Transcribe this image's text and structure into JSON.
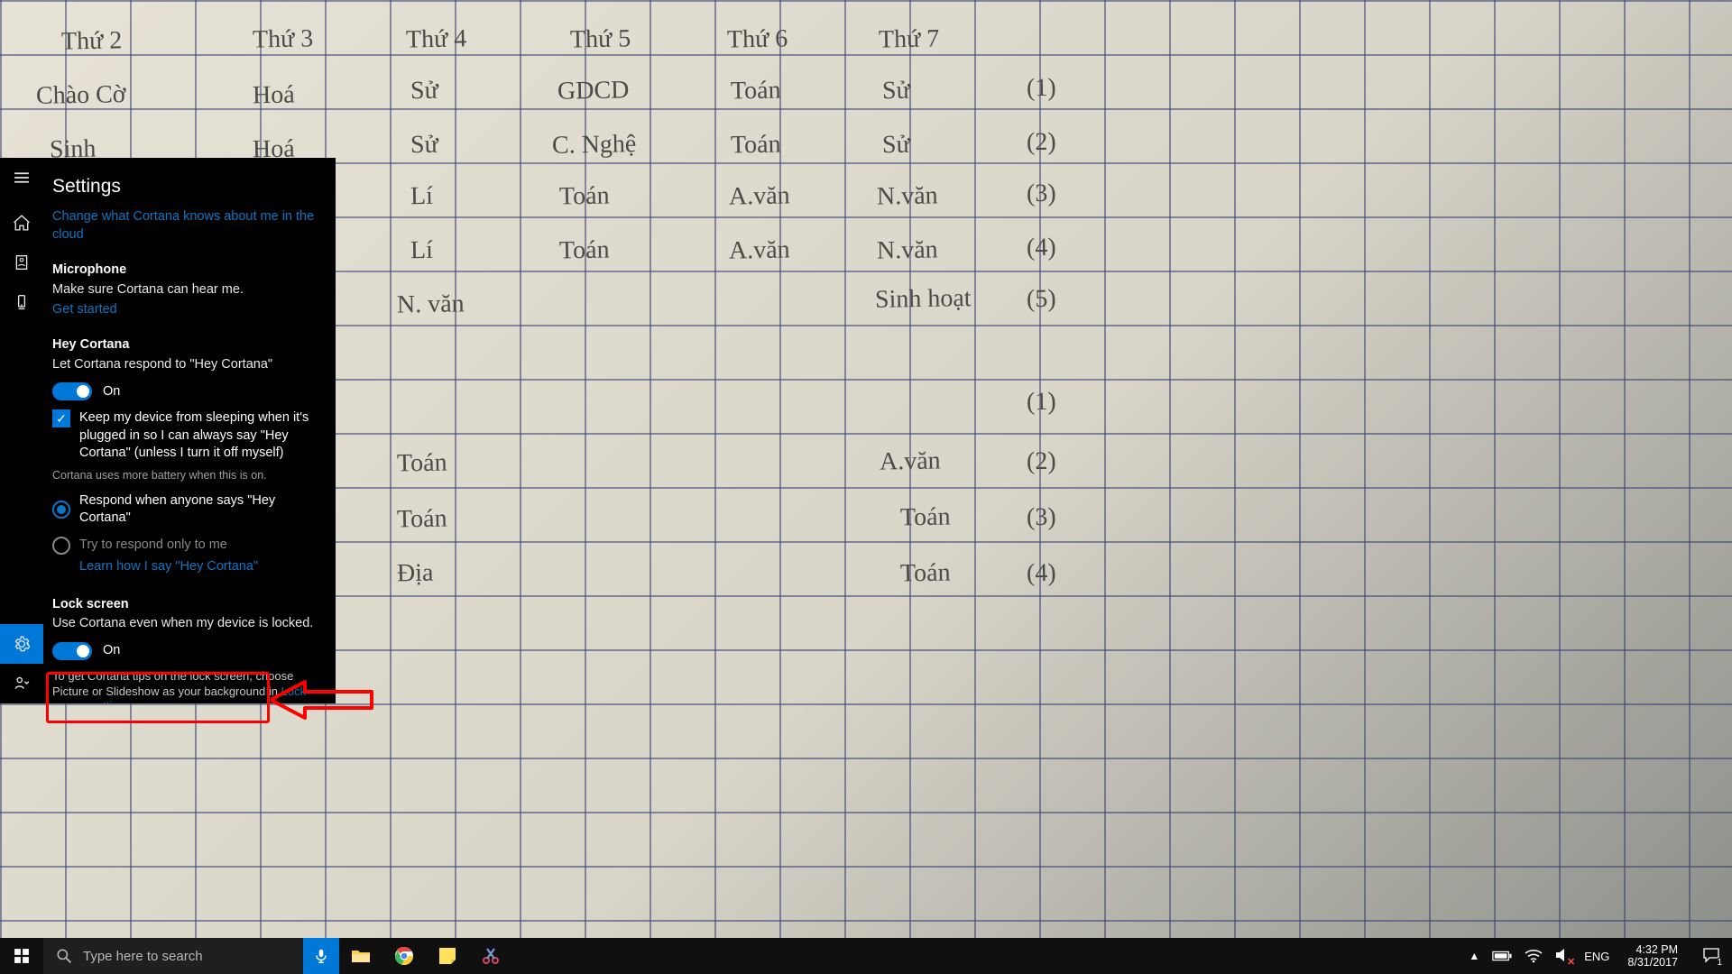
{
  "cortana": {
    "title": "Settings",
    "cloud_link": "Change what Cortana knows about me in the cloud",
    "mic": {
      "title": "Microphone",
      "text": "Make sure Cortana can hear me.",
      "link": "Get started"
    },
    "hey": {
      "title": "Hey Cortana",
      "text": "Let Cortana respond to \"Hey Cortana\"",
      "toggle_label": "On",
      "keep_awake": "Keep my device from sleeping when it's plugged in so I can always say \"Hey Cortana\" (unless I turn it off myself)",
      "battery_hint": "Cortana uses more battery when this is on.",
      "radio_anyone": "Respond when anyone says \"Hey Cortana\"",
      "radio_me": "Try to respond only to me",
      "learn_link": "Learn how I say \"Hey Cortana\""
    },
    "lock": {
      "title": "Lock screen",
      "text": "Use Cortana even when my device is locked.",
      "toggle_label": "On",
      "foot_pre": "To get Cortana tips on the lock screen, choose Picture or Slideshow as your background in ",
      "foot_link": "Lock screen settings",
      "foot_post": "."
    }
  },
  "taskbar": {
    "search_placeholder": "Type here to search",
    "lang": "ENG",
    "time": "4:32 PM",
    "date": "8/31/2017",
    "notification_count": "1"
  },
  "handwriting": {
    "r0": [
      "Thứ 2",
      "Thứ 3",
      "Thứ 4",
      "Thứ 5",
      "Thứ 6",
      "Thứ 7",
      ""
    ],
    "r1": [
      "Chào Cờ",
      "Hoá",
      "Sử",
      "GDCD",
      "Toán",
      "Sử",
      "(1)"
    ],
    "r2": [
      "Sinh",
      "Hoá",
      "Sử",
      "C. Nghệ",
      "Toán",
      "Sử",
      "(2)"
    ],
    "r3": [
      "",
      "",
      "Lí",
      "Toán",
      "A.văn",
      "N.văn",
      "(3)"
    ],
    "r4": [
      "",
      "",
      "Lí",
      "Toán",
      "A.văn",
      "N.văn",
      "(4)"
    ],
    "r5": [
      "",
      "",
      "N. văn",
      "",
      "",
      "Sinh hoạt",
      "(5)"
    ],
    "r6": [
      "",
      "",
      "",
      "",
      "",
      "",
      "(1)"
    ],
    "r7": [
      "",
      "",
      "Toán",
      "",
      "",
      "A.văn",
      "(2)"
    ],
    "r8": [
      "",
      "",
      "Toán",
      "",
      "",
      "Toán",
      "(3)"
    ],
    "r9": [
      "",
      "",
      "Địa",
      "",
      "",
      "Toán",
      "(4)"
    ]
  }
}
